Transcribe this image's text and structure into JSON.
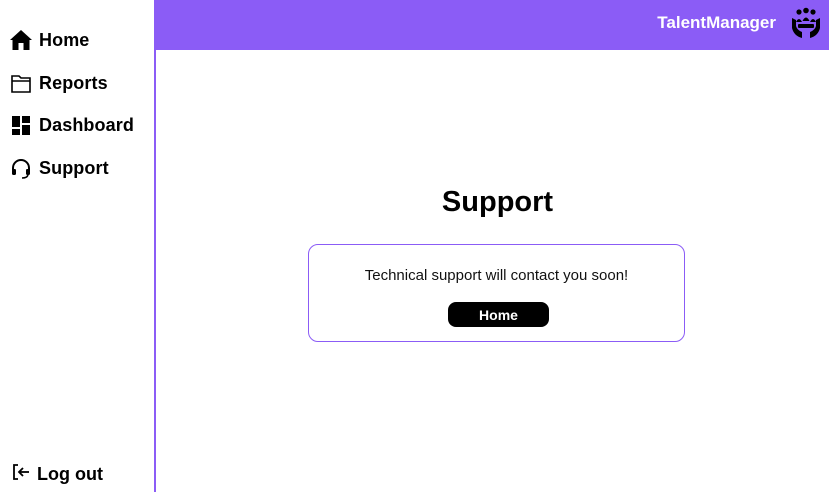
{
  "header": {
    "brand": "TalentManager",
    "logo_icon": "people-in-hands-icon",
    "background_color": "#8b5cf6"
  },
  "sidebar": {
    "items": [
      {
        "label": "Home",
        "icon": "home-icon"
      },
      {
        "label": "Reports",
        "icon": "folder-icon"
      },
      {
        "label": "Dashboard",
        "icon": "dashboard-icon"
      },
      {
        "label": "Support",
        "icon": "headset-icon"
      }
    ],
    "logout": {
      "label": "Log out",
      "icon": "logout-icon"
    }
  },
  "main": {
    "title": "Support",
    "card": {
      "message": "Technical support will contact you soon!",
      "button_label": "Home"
    }
  }
}
